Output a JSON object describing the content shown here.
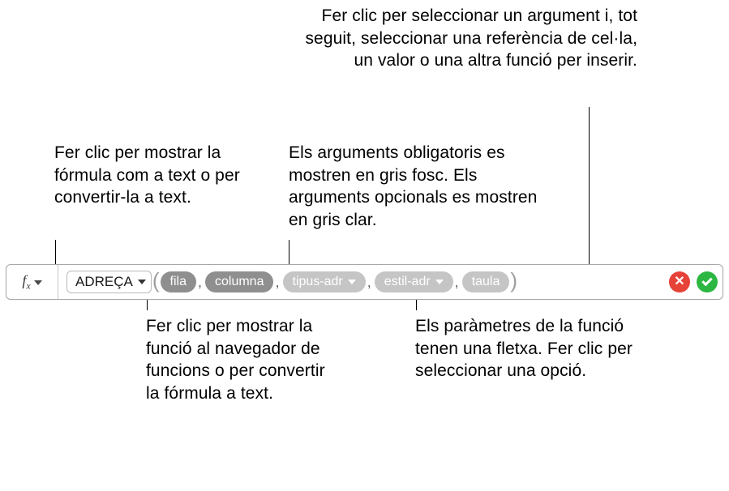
{
  "callouts": {
    "top_right": "Fer clic per seleccionar un argument i, tot seguit, seleccionar una referència de cel·la, un valor o una altra funció per inserir.",
    "top_left": "Fer clic per mostrar la fórmula com a text o per convertir-la a text.",
    "top_mid": "Els arguments obligatoris es mostren en gris fosc. Els arguments opcionals es mostren en gris clar.",
    "bottom_left": "Fer clic per mostrar la funció al navegador de funcions o per convertir la fórmula a text.",
    "bottom_right": "Els paràmetres de la funció tenen una fletxa. Fer clic per seleccionar una opció."
  },
  "formula": {
    "fx_label": "f",
    "fx_sub": "x",
    "function_name": "ADREÇA",
    "args": [
      {
        "label": "fila",
        "required": true,
        "dropdown": false
      },
      {
        "label": "columna",
        "required": true,
        "dropdown": false
      },
      {
        "label": "tipus-adr",
        "required": false,
        "dropdown": true
      },
      {
        "label": "estil-adr",
        "required": false,
        "dropdown": true
      },
      {
        "label": "taula",
        "required": false,
        "dropdown": false
      }
    ],
    "comma": ","
  },
  "icons": {
    "cancel": "cancel",
    "confirm": "confirm"
  }
}
